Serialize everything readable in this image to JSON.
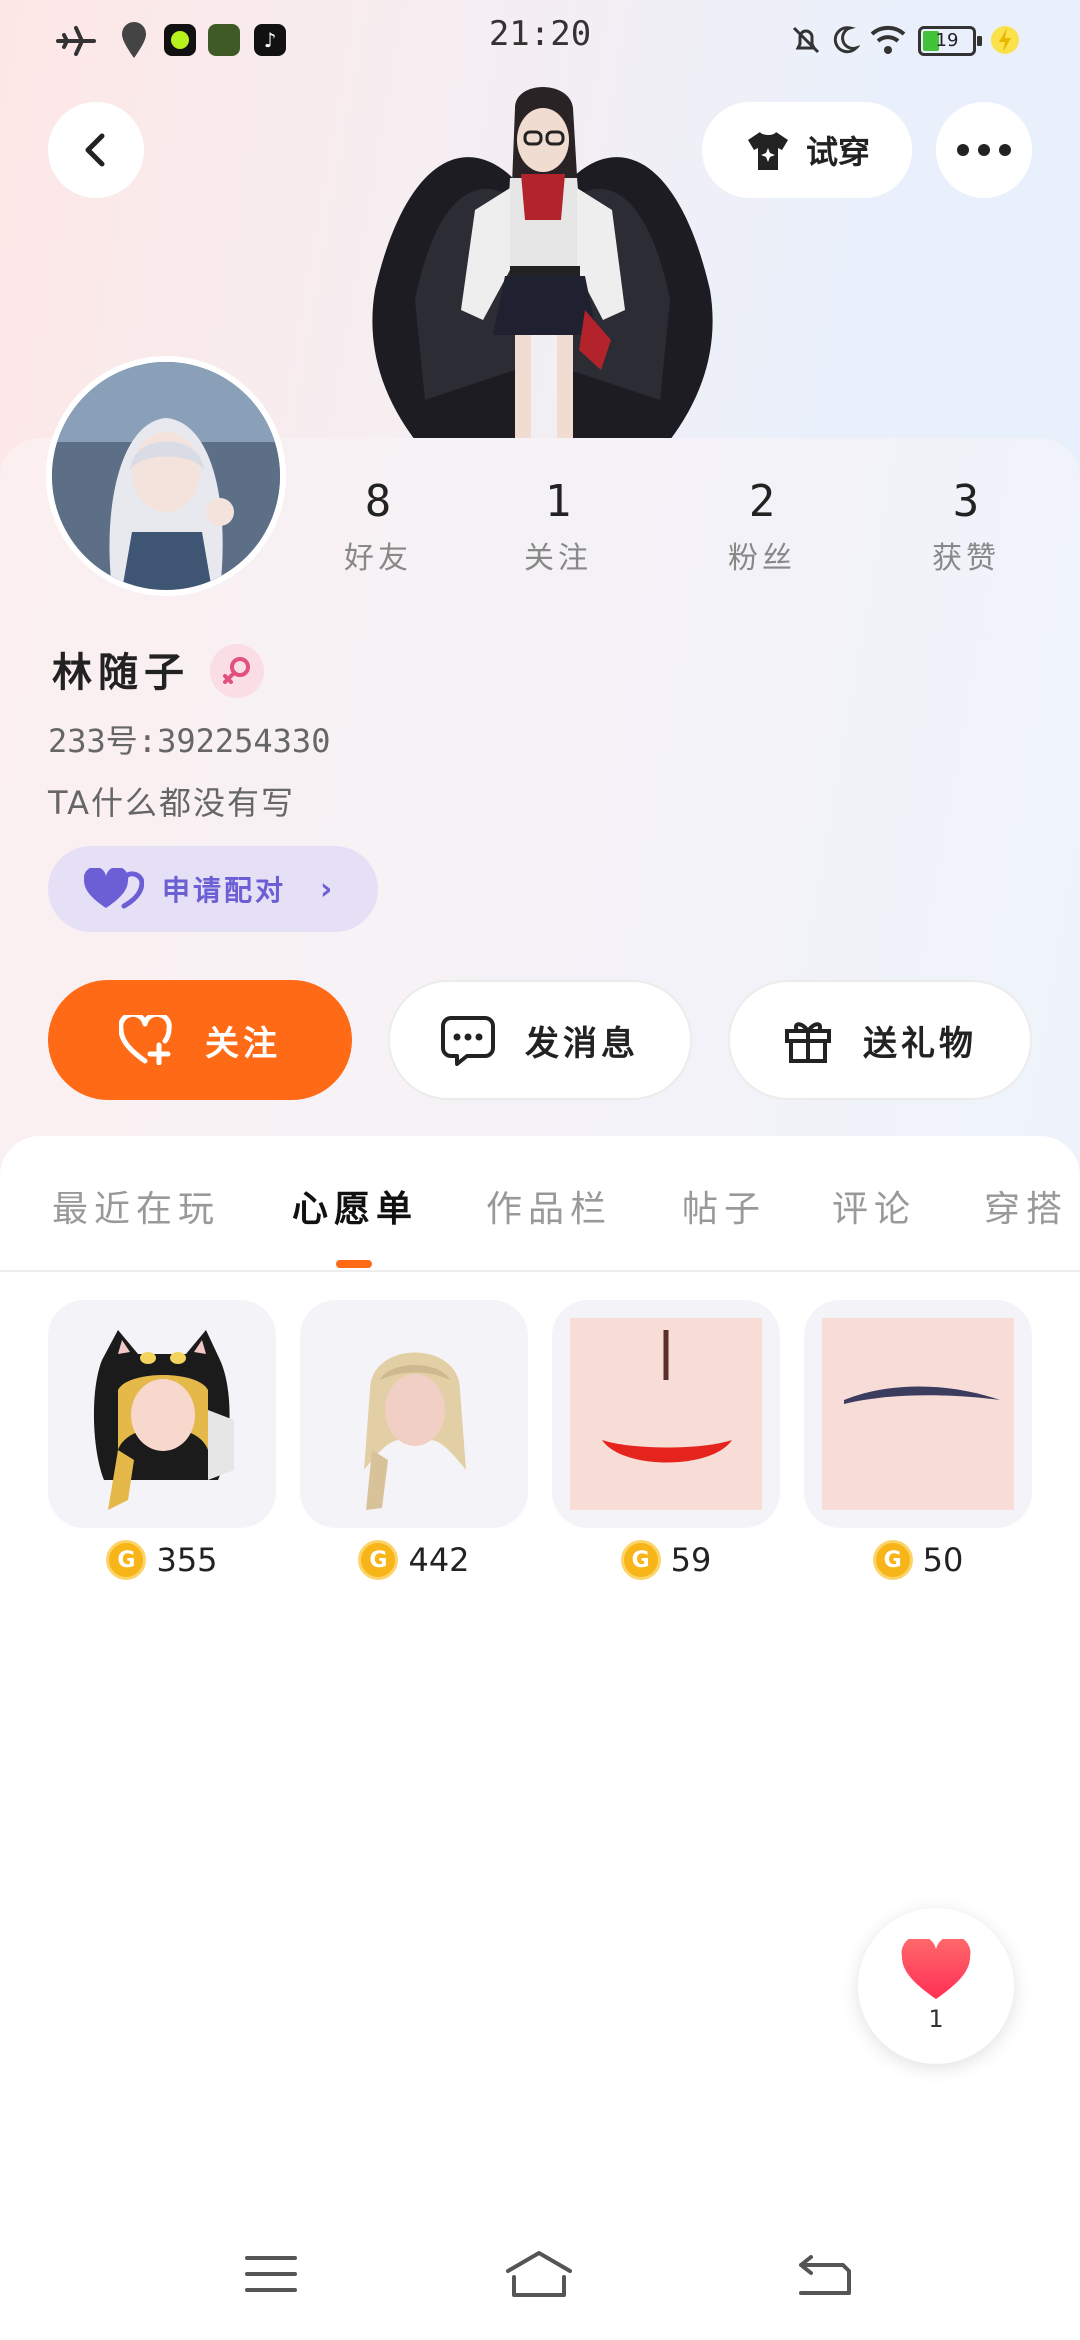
{
  "status_bar": {
    "time": "21:20",
    "battery": "19"
  },
  "header": {
    "try_on_label": "试穿"
  },
  "profile": {
    "stats": [
      {
        "value": "8",
        "label": "好友"
      },
      {
        "value": "1",
        "label": "关注"
      },
      {
        "value": "2",
        "label": "粉丝"
      },
      {
        "value": "3",
        "label": "获赞"
      }
    ],
    "name": "林随子",
    "uid": "233号:392254330",
    "bio": "TA什么都没有写",
    "pair_label": "申请配对"
  },
  "actions": {
    "follow": "关注",
    "message": "发消息",
    "gift": "送礼物"
  },
  "tabs": [
    "最近在玩",
    "心愿单",
    "作品栏",
    "帖子",
    "评论",
    "穿搭"
  ],
  "active_tab": "心愿单",
  "wishlist": [
    {
      "name": "cat-hood-hair",
      "price": "355"
    },
    {
      "name": "blonde-hair",
      "price": "442"
    },
    {
      "name": "mouth-makeup",
      "price": "59"
    },
    {
      "name": "eyebrow-makeup",
      "price": "50"
    }
  ],
  "like_count": "1",
  "colors": {
    "accent": "#ff6a16",
    "pair": "#6c5fd6",
    "coin": "#f7b51a"
  }
}
